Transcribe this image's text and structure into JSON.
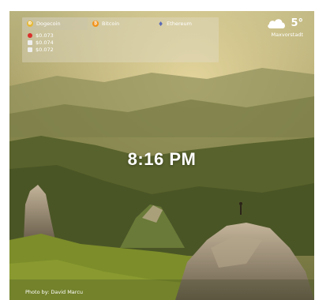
{
  "crypto": {
    "tabs": [
      {
        "label": "Dogecoin",
        "icon": "dogecoin-icon",
        "color": "#e6b93a"
      },
      {
        "label": "Bitcoin",
        "icon": "bitcoin-icon",
        "color": "#f2931a"
      },
      {
        "label": "Ethereum",
        "icon": "ethereum-icon",
        "color": "#5b6bb5"
      }
    ],
    "active_tab": "Dogecoin",
    "prices": [
      {
        "value": "$0.073",
        "marker_color": "#d9302b"
      },
      {
        "value": "$0.074",
        "marker_color": "#eeeeee"
      },
      {
        "value": "$0.072",
        "marker_color": "#eeeeee"
      }
    ]
  },
  "weather": {
    "temperature": "5°",
    "location": "Maxvorstadt",
    "icon": "cloud-icon"
  },
  "clock": {
    "time": "8:16 PM"
  },
  "photo_credit": "Photo by: David Marcu"
}
